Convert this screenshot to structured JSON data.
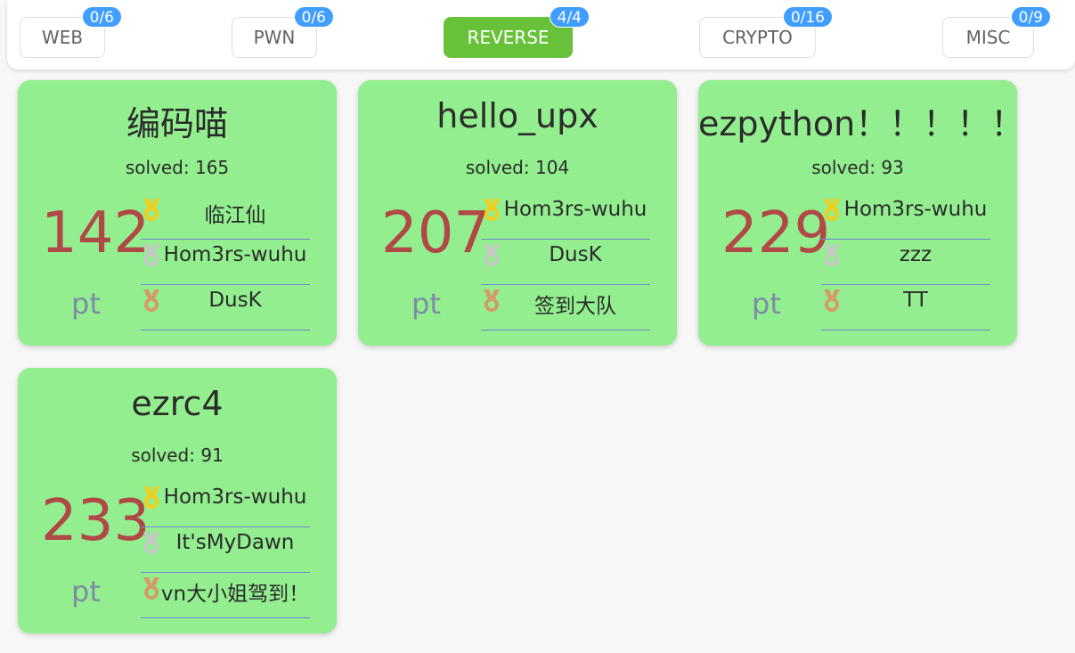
{
  "colors": {
    "active_tab": "#67c23a",
    "badge": "#409eff",
    "card_bg": "#92ee8e",
    "score": "#b04848",
    "pt": "#7e8aa6",
    "gold": "#f2cf1c",
    "silver": "#c7c7c7",
    "bronze": "#d49a68"
  },
  "tabs": [
    {
      "label": "WEB",
      "badge": "0/6",
      "active": false
    },
    {
      "label": "PWN",
      "badge": "0/6",
      "active": false
    },
    {
      "label": "REVERSE",
      "badge": "4/4",
      "active": true
    },
    {
      "label": "CRYPTO",
      "badge": "0/16",
      "active": false
    },
    {
      "label": "MISC",
      "badge": "0/9",
      "active": false
    }
  ],
  "cards": [
    {
      "title": "编码喵",
      "solved": "solved: 165",
      "score": "142",
      "unit": "pt",
      "ranks": [
        {
          "medal": "gold-medal-icon",
          "name": "临江仙"
        },
        {
          "medal": "silver-medal-icon",
          "name": "Hom3rs-wuhu"
        },
        {
          "medal": "bronze-medal-icon",
          "name": "DusK"
        }
      ]
    },
    {
      "title": "hello_upx",
      "solved": "solved: 104",
      "score": "207",
      "unit": "pt",
      "ranks": [
        {
          "medal": "gold-medal-icon",
          "name": "Hom3rs-wuhu"
        },
        {
          "medal": "silver-medal-icon",
          "name": "DusK"
        },
        {
          "medal": "bronze-medal-icon",
          "name": "签到大队"
        }
      ]
    },
    {
      "title": "ezpython！！！！！",
      "solved": "solved: 93",
      "score": "229",
      "unit": "pt",
      "ranks": [
        {
          "medal": "gold-medal-icon",
          "name": "Hom3rs-wuhu"
        },
        {
          "medal": "silver-medal-icon",
          "name": "zzz"
        },
        {
          "medal": "bronze-medal-icon",
          "name": "TT"
        }
      ]
    },
    {
      "title": "ezrc4",
      "solved": "solved: 91",
      "score": "233",
      "unit": "pt",
      "ranks": [
        {
          "medal": "gold-medal-icon",
          "name": "Hom3rs-wuhu"
        },
        {
          "medal": "silver-medal-icon",
          "name": "It'sMyDawn"
        },
        {
          "medal": "bronze-medal-icon",
          "name": "vn大小姐驾到！"
        }
      ]
    }
  ]
}
